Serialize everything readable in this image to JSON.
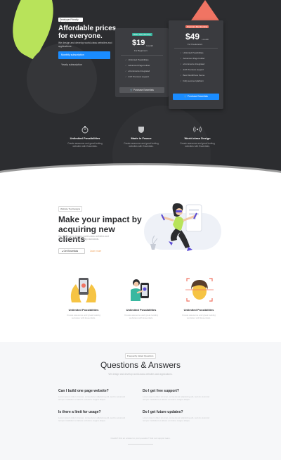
{
  "hero": {
    "tag": "Developer Friendly Template",
    "title_line1": "Affordable prices",
    "title_line2": "for everyone.",
    "subtitle": "We design and develop world-class websites and applications.",
    "monthly_label": "Monthly subscription",
    "yearly_label": "Yearly subscription"
  },
  "plans": [
    {
      "badge": "Basic Membership",
      "price": "$19",
      "per": "/ month",
      "for": "For Beginners",
      "features": [
        "Unlimited Possibilities",
        "Advanced Page builder",
        "eCommerce Integrated",
        "24/7 Premium support"
      ],
      "button": "Purchase Essentials"
    },
    {
      "badge": "Premium Membership",
      "price": "$49",
      "per": "/ month",
      "for": "For Freelancers",
      "features": [
        "Unlimited Possibilities",
        "Advanced Page builder",
        "eCommerce Integrated",
        "24/7 Premium support",
        "Best WordPress theme",
        "Fully secured platform"
      ],
      "button": "Purchase Essentials"
    }
  ],
  "hero_features": [
    {
      "icon": "stopwatch-icon",
      "title": "Unlimited Possibilities",
      "desc1": "Create awesome and great looking",
      "desc2": "websites with Essentials."
    },
    {
      "icon": "shield-icon",
      "title": "Made in France",
      "desc1": "Create awesome and great looking",
      "desc2": "websites with Essentials."
    },
    {
      "icon": "signal-icon",
      "title": "World-class Design",
      "desc1": "Create awesome and great looking",
      "desc2": "websites with Essentials."
    }
  ],
  "impact": {
    "tag": "Website Top Designs",
    "title_line1": "Make your impact by",
    "title_line2": "acquiring new clients",
    "subtitle": "We design and develop world-class websites and applications with high quality standards.",
    "cta_primary": "Get Essentials",
    "cta_link": "Learn more"
  },
  "features": [
    {
      "title": "Unlimited Possibilities",
      "desc1": "Create awesome and great looking",
      "desc2": "websites with Essentials."
    },
    {
      "title": "Unlimited Possibilities",
      "desc1": "Create awesome and great looking",
      "desc2": "websites with Essentials."
    },
    {
      "title": "Unlimited Possibilities",
      "desc1": "Create awesome and great looking",
      "desc2": "websites with Essentials."
    }
  ],
  "faq": {
    "tag": "Frequently Asked Questions",
    "title": "Questions & Answers",
    "subtitle": "We design and develop world-class websites and applications.",
    "items": [
      {
        "q": "Can I build one page website?",
        "a1": "Lorem ipsum dolor sit amet, consectetur adipiscing elit, sed do eiusmod",
        "a2": "tempor incididunt ut labore et dolore magna aliqua."
      },
      {
        "q": "Do I get free support?",
        "a1": "Lorem ipsum dolor sit amet, consectetur adipiscing elit, sed do eiusmod",
        "a2": "tempor incididunt ut labore et dolore magna aliqua."
      },
      {
        "q": "Is there a limit for usage?",
        "a1": "Lorem ipsum dolor sit amet, consectetur adipiscing elit, sed do eiusmod",
        "a2": "tempor incididunt ut labore et dolore magna aliqua."
      },
      {
        "q": "Do I get future updates?",
        "a1": "Lorem ipsum dolor sit amet, consectetur adipiscing elit, sed do eiusmod",
        "a2": "tempor incididunt ut labore et dolore magna aliqua."
      }
    ],
    "footer": "Couldn't find an answer to your question? Ask our support team."
  },
  "colors": {
    "hero_bg": "#2c2d30",
    "accent_blue": "#1a8cff",
    "accent_coral": "#f07463",
    "accent_green": "#b8e35a",
    "accent_teal": "#39b8a0",
    "accent_yellow": "#f6c444"
  }
}
